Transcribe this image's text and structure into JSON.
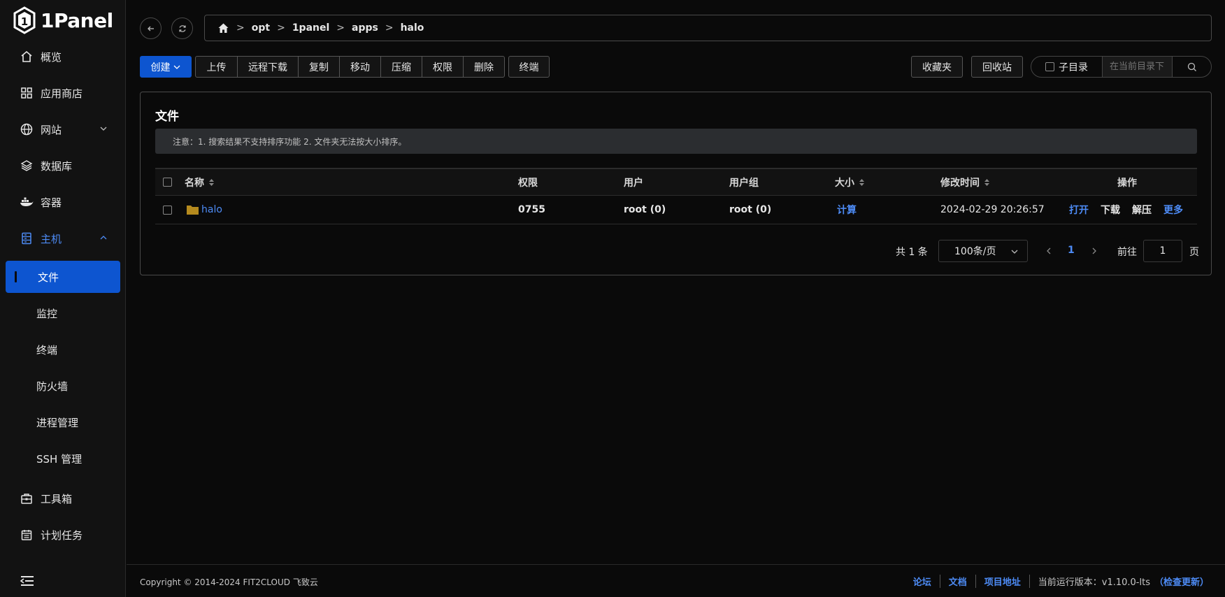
{
  "app": {
    "name": "1Panel"
  },
  "colors": {
    "accent": "#0d55d0",
    "link": "#4d8bf5",
    "background": "#0a0a0a"
  },
  "sidebar": {
    "items": [
      {
        "label": "概览",
        "icon": "home-icon"
      },
      {
        "label": "应用商店",
        "icon": "grid-icon"
      },
      {
        "label": "网站",
        "icon": "globe-icon"
      },
      {
        "label": "数据库",
        "icon": "layers-icon"
      },
      {
        "label": "容器",
        "icon": "docker-icon"
      },
      {
        "label": "主机",
        "icon": "server-icon"
      },
      {
        "label": "工具箱",
        "icon": "toolbox-icon"
      },
      {
        "label": "计划任务",
        "icon": "calendar-icon"
      }
    ],
    "host_sub": [
      "文件",
      "监控",
      "终端",
      "防火墙",
      "进程管理",
      "SSH 管理"
    ]
  },
  "breadcrumb": [
    "opt",
    "1panel",
    "apps",
    "halo"
  ],
  "toolbar": {
    "create": "创建",
    "group": [
      "上传",
      "远程下载",
      "复制",
      "移动",
      "压缩",
      "权限",
      "删除"
    ],
    "terminal": "终端",
    "favorites": "收藏夹",
    "recycle": "回收站",
    "subdir": "子目录",
    "search_placeholder": "在当前目录下"
  },
  "panel": {
    "title": "文件",
    "notice": "注意：1. 搜索结果不支持排序功能 2. 文件夹无法按大小排序。"
  },
  "table": {
    "headers": [
      "名称",
      "权限",
      "用户",
      "用户组",
      "大小",
      "修改时间",
      "操作"
    ],
    "rows": [
      {
        "name": "halo",
        "mode": "0755",
        "user": "root (0)",
        "group": "root (0)",
        "size": "计算",
        "mtime": "2024-02-29 20:26:57",
        "ops": [
          "打开",
          "下载",
          "解压",
          "更多"
        ]
      }
    ]
  },
  "pagination": {
    "total": "共 1 条",
    "page_size": "100条/页",
    "current": "1",
    "goto": "前往",
    "goto_value": "1",
    "page_suffix": "页"
  },
  "footer": {
    "copyright": "Copyright © 2014-2024 FIT2CLOUD 飞致云",
    "links": [
      "论坛",
      "文档",
      "项目地址"
    ],
    "version_label": "当前运行版本：v1.10.0-lts",
    "check_update": "（检查更新）"
  }
}
